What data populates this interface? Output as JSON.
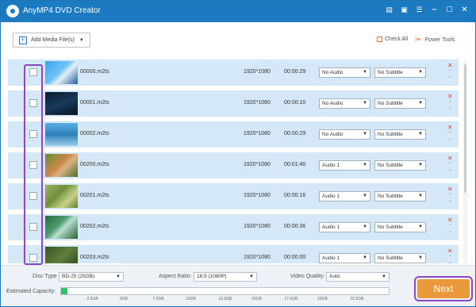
{
  "app": {
    "title": "AnyMP4 DVD Creator"
  },
  "toolbar": {
    "add_media_label": "Add Media File(s)",
    "check_all_label": "Check All",
    "power_tools_label": "Power Tools"
  },
  "files": [
    {
      "name": "00000.m2ts",
      "resolution": "1920*1080",
      "duration": "00:00:29",
      "audio": "No Audio",
      "subtitle": "No Subtitle",
      "thumb": "blue"
    },
    {
      "name": "00001.m2ts",
      "resolution": "1920*1080",
      "duration": "00:00:10",
      "audio": "No Audio",
      "subtitle": "No Subtitle",
      "thumb": "dark"
    },
    {
      "name": "00002.m2ts",
      "resolution": "1920*1080",
      "duration": "00:00:29",
      "audio": "No Audio",
      "subtitle": "No Subtitle",
      "thumb": "screens"
    },
    {
      "name": "00200.m2ts",
      "resolution": "1920*1080",
      "duration": "00:01:40",
      "audio": "Audio 1",
      "subtitle": "No Subtitle",
      "thumb": "nature"
    },
    {
      "name": "00201.m2ts",
      "resolution": "1920*1080",
      "duration": "00:00:16",
      "audio": "Audio 1",
      "subtitle": "No Subtitle",
      "thumb": "greenblur"
    },
    {
      "name": "00202.m2ts",
      "resolution": "1920*1080",
      "duration": "00:00:36",
      "audio": "Audio 1",
      "subtitle": "No Subtitle",
      "thumb": "waterfall"
    },
    {
      "name": "00203.m2ts",
      "resolution": "1920*1080",
      "duration": "00:00:00",
      "audio": "Audio 1",
      "subtitle": "No Subtitle",
      "thumb": "forest"
    }
  ],
  "bottom": {
    "disc_type_label": "Disc Type",
    "disc_type_value": "BD-25 (25GB)",
    "aspect_ratio_label": "Aspect Ratio:",
    "aspect_ratio_value": "16:9 (1080P)",
    "video_quality_label": "Video Quality:",
    "video_quality_value": "Auto",
    "capacity_label": "Estimated Capacity:",
    "capacity_fraction": 0.02,
    "capacity_ticks": [
      "2.5GB",
      "5GB",
      "7.5GB",
      "10GB",
      "12.5GB",
      "15GB",
      "17.5GB",
      "20GB",
      "22.5GB"
    ],
    "next_label": "Next"
  },
  "colors": {
    "titlebar": "#1c7ac0",
    "row_bg": "#d5e8f7",
    "accent_orange": "#e9993a",
    "highlight_purple": "#8a48c2",
    "capacity_green": "#36c066"
  },
  "icons": {
    "titlebar": [
      "file-icon",
      "save-icon",
      "menu-icon",
      "minimize-icon",
      "maximize-icon",
      "close-icon"
    ]
  }
}
